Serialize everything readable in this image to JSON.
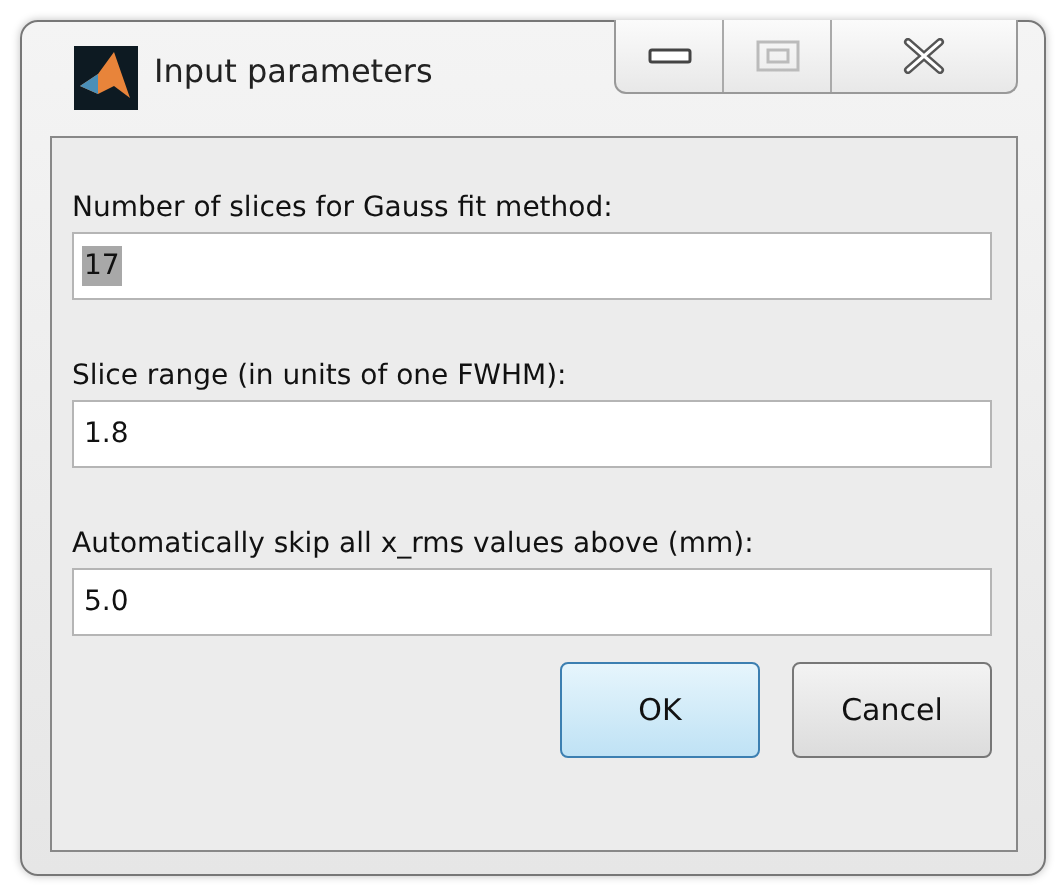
{
  "window": {
    "title": "Input parameters"
  },
  "fields": [
    {
      "label": "Number of slices for Gauss fit method:",
      "value": "17",
      "selected": true
    },
    {
      "label": "Slice range (in units of one FWHM):",
      "value": "1.8",
      "selected": false
    },
    {
      "label": "Automatically skip all x_rms values above (mm):",
      "value": "5.0",
      "selected": false
    }
  ],
  "buttons": [
    {
      "label": "OK",
      "default": true
    },
    {
      "label": "Cancel",
      "default": false
    }
  ]
}
